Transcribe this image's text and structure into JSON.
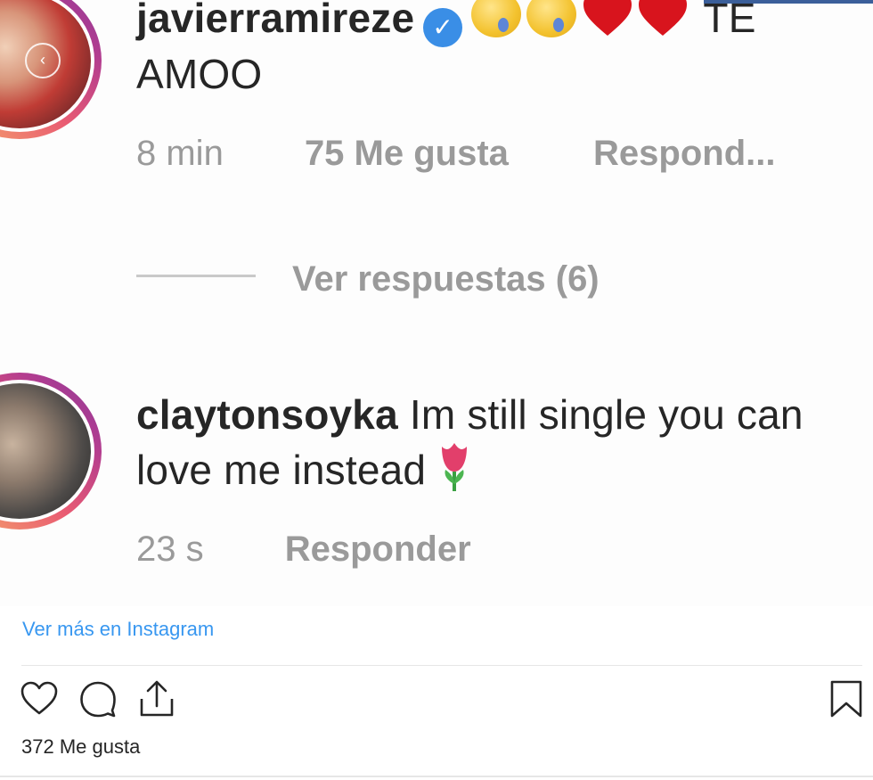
{
  "comment1": {
    "username": "javierramireze",
    "text_end": "TE AMOO",
    "time": "8 min",
    "likes": "75 Me gusta",
    "reply": "Respond..."
  },
  "view_replies": "Ver respuestas (6)",
  "comment2": {
    "username": "claytonsoyka",
    "text": "Im still single you can love me instead",
    "time": "23 s",
    "reply": "Responder"
  },
  "embed": {
    "see_more": "Ver más en Instagram",
    "likes": "372 Me gusta"
  },
  "icons": [
    "heart-icon",
    "comment-icon",
    "share-icon",
    "bookmark-icon",
    "verified-icon",
    "sleepy-emoji-icon",
    "red-heart-emoji-icon",
    "tulip-emoji-icon"
  ],
  "colors": {
    "link": "#3897f0",
    "verified": "#3a8ee6",
    "meta_text": "#9a9a9a",
    "ring_pink": "#e95b72"
  }
}
